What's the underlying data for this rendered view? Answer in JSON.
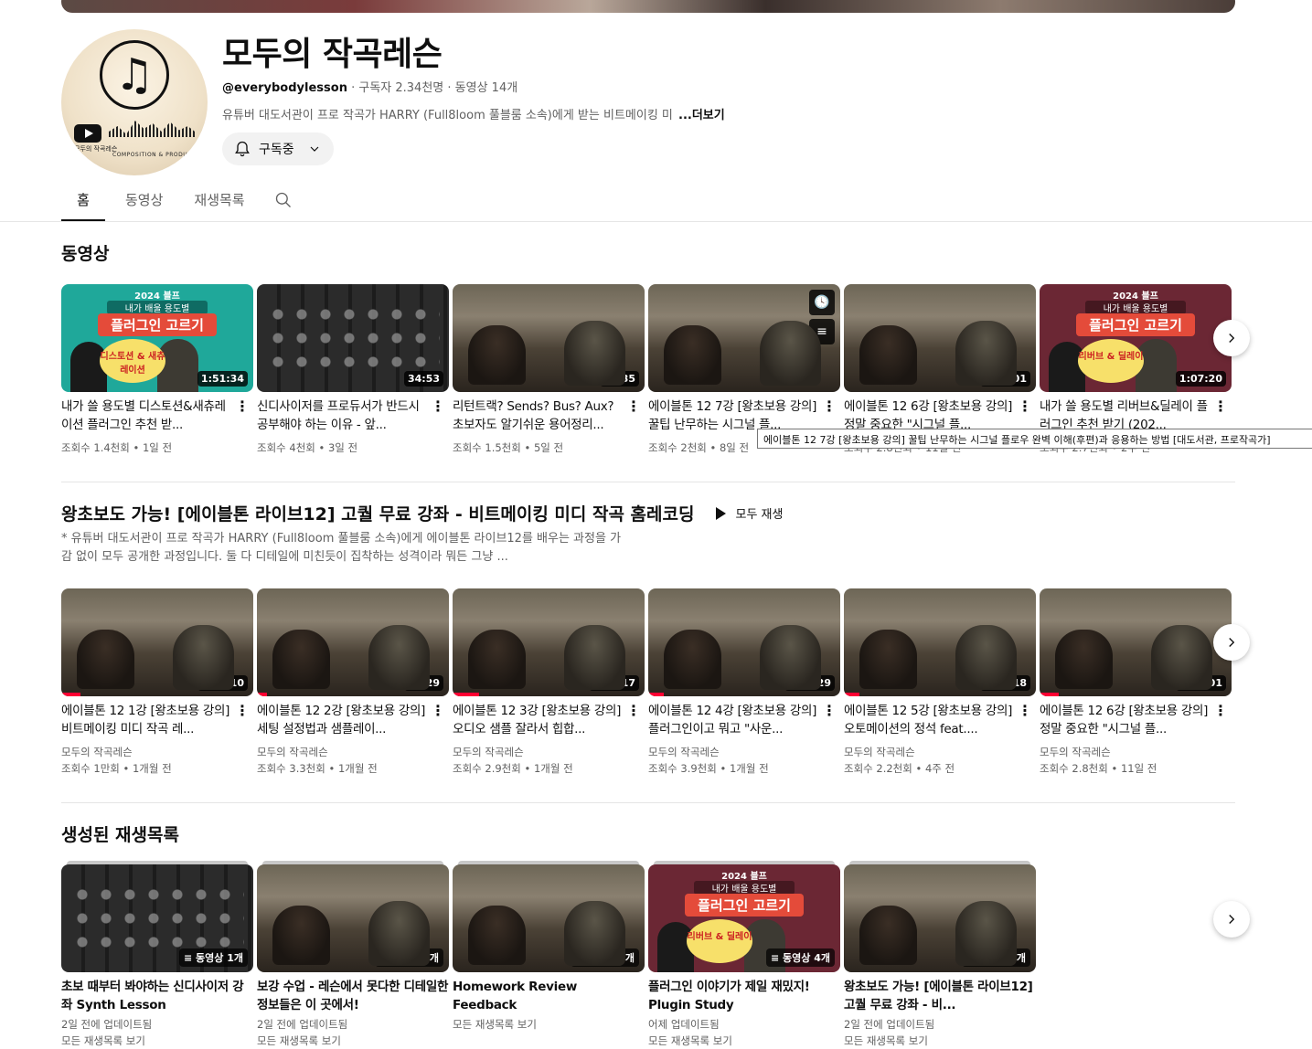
{
  "channel": {
    "title": "모두의 작곡레슨",
    "handle": "@everybodylesson",
    "subscribers": "구독자 2.34천명",
    "video_count": "동영상 14개",
    "description": "유튜버 대도서관이 프로 작곡가 HARRY (Full8loom 풀블룸 소속)에게 받는 비트메이킹 미",
    "more_label": "...더보기",
    "subscribe_label": "구독중",
    "avatar_text": "모두의 작곡레슨",
    "avatar_sub": "COMPOSITION & PRODUCTION"
  },
  "tabs": [
    "홈",
    "동영상",
    "재생목록"
  ],
  "sections": {
    "videos_title": "동영상",
    "playlist_title": "왕초보도 가능! [에이블톤 라이브12] 고퀄 무료 강좌 - 비트메이킹 미디 작곡 홈레코딩",
    "play_all": "모두 재생",
    "playlist_desc": "* 유튜버 대도서관이 프로 작곡가 HARRY (Full8loom 풀블룸 소속)에게 에이블톤 라이브12를 배우는 과정을 가감 없이 모두 공개한 과정입니다. 둘 다 디테일에 미친듯이 집착하는 성격이라 뭐든 그냥 ...",
    "created_title": "생성된 재생목록"
  },
  "videos": [
    {
      "title": "내가 쓸 용도별 디스토션&새츄레이션 플러그인 추천 받...",
      "duration": "1:51:34",
      "meta": "조회수 1.4천회 • 1일 전",
      "thumb": "promo-green",
      "promo": [
        "2024 블프",
        "내가 배울 용도별",
        "플러그인 고르기",
        "디스토션 & 새츄레이션"
      ]
    },
    {
      "title": "신디사이저를 프로듀서가 반드시 공부해야 하는 이유 - 앞...",
      "duration": "34:53",
      "meta": "조회수 4천회 • 3일 전",
      "thumb": "synth"
    },
    {
      "title": "리턴트랙? Sends? Bus? Aux? 초보자도 알기쉬운 용어정리...",
      "duration": "58:35",
      "meta": "조회수 1.5천회 • 5일 전",
      "thumb": "studio"
    },
    {
      "title": "에이블톤 12 7강 [왕초보용 강의] 꿀팁 난무하는 시그널 플...",
      "duration": "",
      "meta": "조회수 2천회 • 8일 전",
      "thumb": "studio"
    },
    {
      "title": "에이블톤 12 6강 [왕초보용 강의] 정말 중요한 \"시그널 플...",
      "duration": "1:27:01",
      "meta": "조회수 2.8천회 • 11일 전",
      "thumb": "studio"
    },
    {
      "title": "내가 쓸 용도별 리버브&딜레이 플러그인 추천 받기 (202...",
      "duration": "1:07:20",
      "meta": "조회수 2.7천회 • 2주 전",
      "thumb": "promo-maroon",
      "promo": [
        "2024 블프",
        "내가 배울 용도별",
        "플러그인 고르기",
        "리버브 & 딜레이"
      ]
    }
  ],
  "tooltip": "에이블톤 12 7강 [왕초보용 강의] 꿀팁 난무하는 시그널 플로우 완벽 이해(후편)과 응용하는 방법 [대도서관, 프로작곡가]",
  "playlist_videos": [
    {
      "title": "에이블톤 12 1강 [왕초보용 강의] 비트메이킹 미디 작곡 레...",
      "duration": "1:32:10",
      "channel": "모두의 작곡레슨",
      "meta": "조회수 1만회 • 1개월 전"
    },
    {
      "title": "에이블톤 12 2강 [왕초보용 강의] 세팅 설정법과 샘플레이...",
      "duration": "52:29",
      "channel": "모두의 작곡레슨",
      "meta": "조회수 3.3천회 • 1개월 전"
    },
    {
      "title": "에이블톤 12 3강 [왕초보용 강의] 오디오 샘플 잘라서 힙합...",
      "duration": "1:25:17",
      "channel": "모두의 작곡레슨",
      "meta": "조회수 2.9천회 • 1개월 전"
    },
    {
      "title": "에이블톤 12 4강 [왕초보용 강의] 플러그인이고 뭐고 \"사운...",
      "duration": "1:51:29",
      "channel": "모두의 작곡레슨",
      "meta": "조회수 3.9천회 • 1개월 전"
    },
    {
      "title": "에이블톤 12 5강 [왕초보용 강의] 오토메이션의 정석 feat....",
      "duration": "1:20:18",
      "channel": "모두의 작곡레슨",
      "meta": "조회수 2.2천회 • 4주 전"
    },
    {
      "title": "에이블톤 12 6강 [왕초보용 강의] 정말 중요한 \"시그널 플...",
      "duration": "1:27:01",
      "channel": "모두의 작곡레슨",
      "meta": "조회수 2.8천회 • 11일 전"
    }
  ],
  "playlists": [
    {
      "title": "초보 때부터 봐야하는 신디사이저 강좌 Synth Lesson",
      "count": "동영상 1개",
      "updated": "2일 전에 업데이트됨",
      "link": "모든 재생목록 보기",
      "thumb": "synth"
    },
    {
      "title": "보강 수업 - 레슨에서 못다한 디테일한 정보들은 이 곳에서!",
      "count": "동영상 1개",
      "updated": "2일 전에 업데이트됨",
      "link": "모든 재생목록 보기",
      "thumb": "studio"
    },
    {
      "title": "Homework Review Feedback",
      "count": "동영상 1개",
      "updated": "",
      "link": "모든 재생목록 보기",
      "thumb": "studio"
    },
    {
      "title": "플러그인 이야기가 제일 재밌지! Plugin Study",
      "count": "동영상 4개",
      "updated": "어제 업데이트됨",
      "link": "모든 재생목록 보기",
      "thumb": "promo-maroon",
      "promo": [
        "2024 블프",
        "내가 배울 용도별",
        "플러그인 고르기",
        "리버브 & 딜레이"
      ]
    },
    {
      "title": "왕초보도 가능! [에이블톤 라이브12] 고퀄 무료 강좌 - 비...",
      "count": "동영상 8개",
      "updated": "2일 전에 업데이트됨",
      "link": "모든 재생목록 보기",
      "thumb": "studio"
    }
  ],
  "icons": {
    "next": "chevron-right-icon",
    "bell": "bell-icon",
    "search": "search-icon"
  }
}
